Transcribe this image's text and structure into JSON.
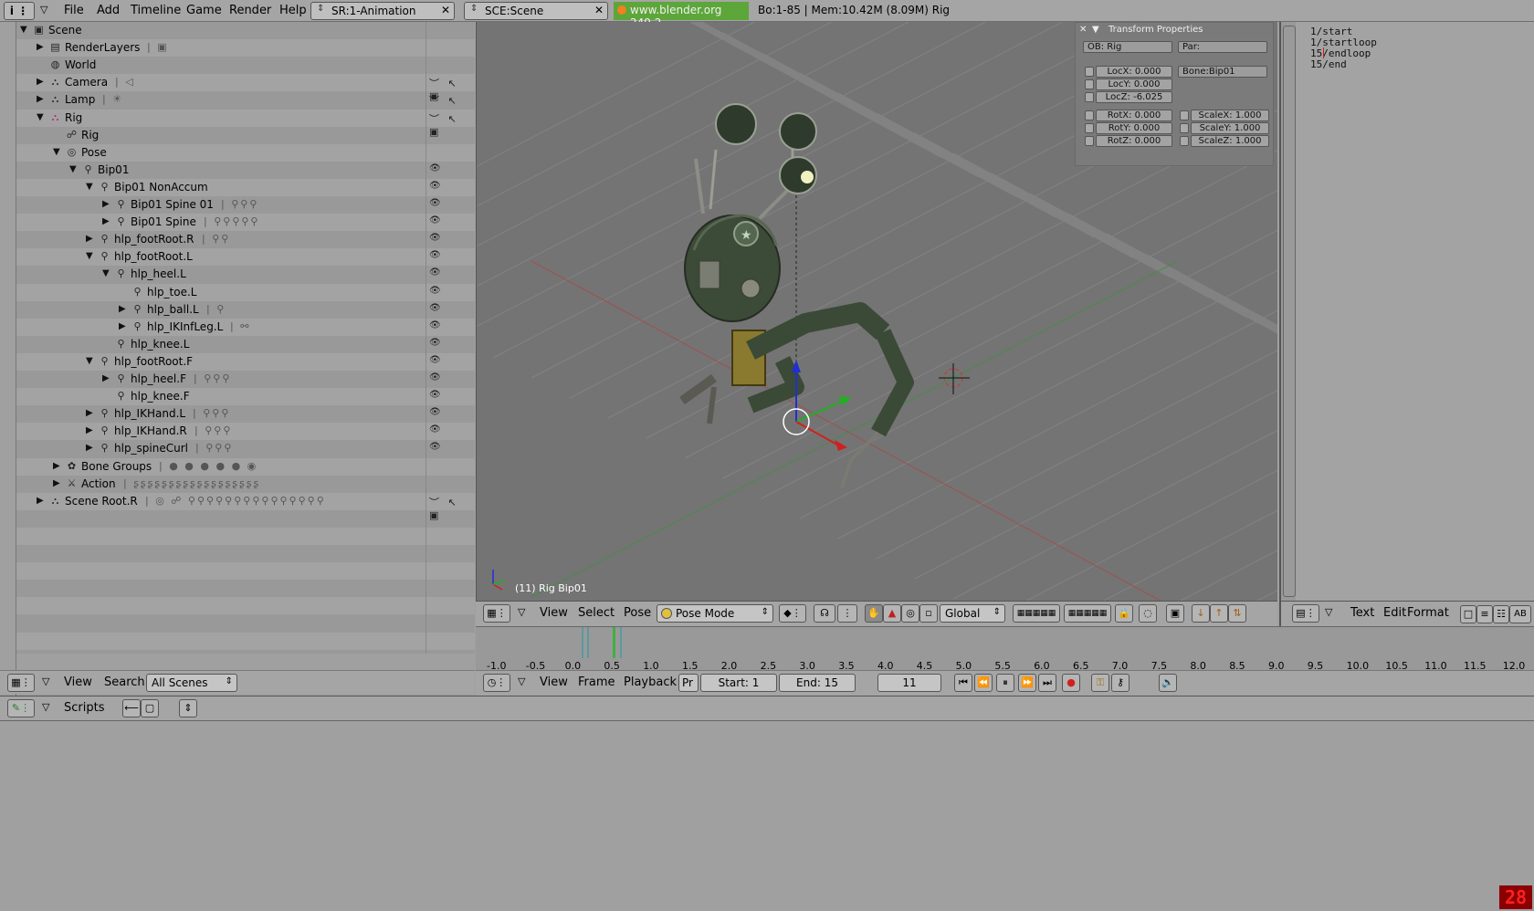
{
  "topbar": {
    "menus": [
      "File",
      "Add",
      "Timeline",
      "Game",
      "Render",
      "Help"
    ],
    "screen_field": "SR:1-Animation",
    "scene_field": "SCE:Scene",
    "url": "www.blender.org 249.2",
    "stats": "Bo:1-85  | Mem:10.42M (8.09M) Rig"
  },
  "outliner": {
    "rows": [
      {
        "label": "Scene"
      },
      {
        "label": "RenderLayers"
      },
      {
        "label": "World"
      },
      {
        "label": "Camera"
      },
      {
        "label": "Lamp"
      },
      {
        "label": "Rig"
      },
      {
        "label": "Rig"
      },
      {
        "label": "Pose"
      },
      {
        "label": "Bip01"
      },
      {
        "label": "Bip01 NonAccum"
      },
      {
        "label": "Bip01 Spine 01"
      },
      {
        "label": "Bip01 Spine"
      },
      {
        "label": "hlp_footRoot.R"
      },
      {
        "label": "hlp_footRoot.L"
      },
      {
        "label": "hlp_heel.L"
      },
      {
        "label": "hlp_toe.L"
      },
      {
        "label": "hlp_ball.L"
      },
      {
        "label": "hlp_IKInfLeg.L"
      },
      {
        "label": "hlp_knee.L"
      },
      {
        "label": "hlp_footRoot.F"
      },
      {
        "label": "hlp_heel.F"
      },
      {
        "label": "hlp_knee.F"
      },
      {
        "label": "hlp_IKHand.L"
      },
      {
        "label": "hlp_IKHand.R"
      },
      {
        "label": "hlp_spineCurl"
      },
      {
        "label": "Bone Groups"
      },
      {
        "label": "Action"
      },
      {
        "label": "Scene Root.R"
      }
    ],
    "header": {
      "view": "View",
      "search": "Search",
      "scope": "All Scenes"
    }
  },
  "viewport": {
    "status": "(11) Rig Bip01",
    "transform": {
      "title": "Transform Properties",
      "ob": "OB: Rig",
      "par": "Par:",
      "bone": "Bone:Bip01",
      "locx": "LocX: 0.000",
      "locy": "LocY: 0.000",
      "locz": "LocZ: -6.025",
      "rotx": "RotX: 0.000",
      "roty": "RotY: 0.000",
      "rotz": "RotZ: 0.000",
      "scalex": "ScaleX: 1.000",
      "scaley": "ScaleY: 1.000",
      "scalez": "ScaleZ: 1.000"
    },
    "header": {
      "view": "View",
      "select": "Select",
      "pose": "Pose",
      "mode": "Pose Mode",
      "orientation": "Global"
    }
  },
  "text_editor": {
    "lines": [
      "1/start",
      "1/startloop",
      "15/endloop",
      "15/end"
    ],
    "header": {
      "text": "Text",
      "edit": "Edit",
      "format": "Format",
      "ab": "AB"
    }
  },
  "timeline": {
    "ticks": [
      "-1.0",
      "-0.5",
      "0.0",
      "0.5",
      "1.0",
      "1.5",
      "2.0",
      "2.5",
      "3.0",
      "3.5",
      "4.0",
      "4.5",
      "5.0",
      "5.5",
      "6.0",
      "6.5",
      "7.0",
      "7.5",
      "8.0",
      "8.5",
      "9.0",
      "9.5",
      "10.0",
      "10.5",
      "11.0",
      "11.5",
      "12.0"
    ],
    "header": {
      "view": "View",
      "frame": "Frame",
      "playback": "Playback",
      "pr": "Pr",
      "start": "Start: 1",
      "end": "End: 15",
      "current": "11"
    }
  },
  "scripts_bar": {
    "label": "Scripts"
  },
  "fps": "28"
}
